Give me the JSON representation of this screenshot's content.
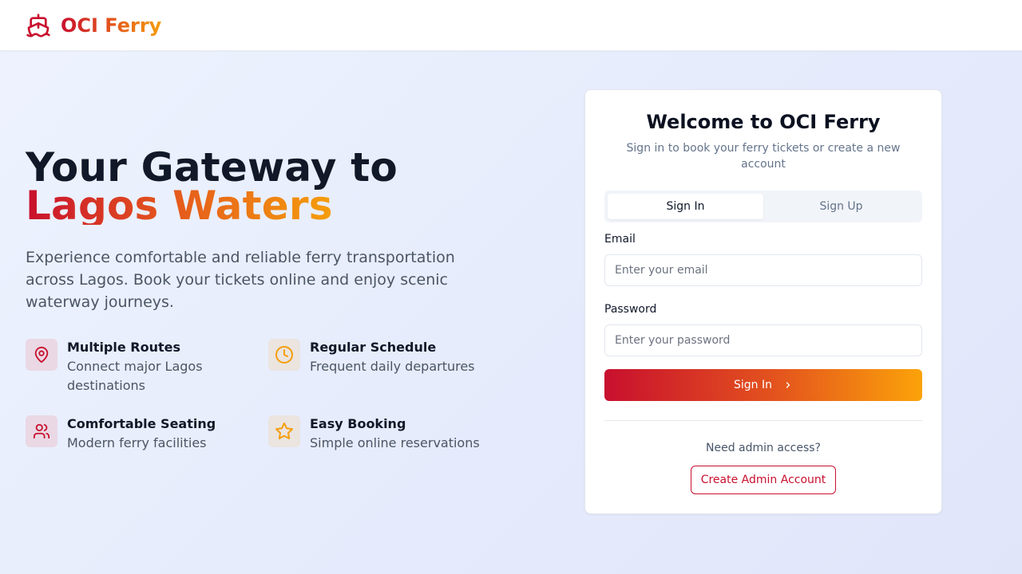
{
  "header": {
    "brand": "OCI Ferry",
    "logo_icon": "ship-icon"
  },
  "hero": {
    "title_line1": "Your Gateway to",
    "title_line2": "Lagos Waters",
    "description": "Experience comfortable and reliable ferry transportation across Lagos. Book your tickets online and enjoy scenic waterway journeys."
  },
  "features": [
    {
      "icon": "map-pin-icon",
      "title": "Multiple Routes",
      "description": "Connect major Lagos destinations"
    },
    {
      "icon": "clock-icon",
      "title": "Regular Schedule",
      "description": "Frequent daily departures"
    },
    {
      "icon": "users-icon",
      "title": "Comfortable Seating",
      "description": "Modern ferry facilities"
    },
    {
      "icon": "star-icon",
      "title": "Easy Booking",
      "description": "Simple online reservations"
    }
  ],
  "auth": {
    "title": "Welcome to OCI Ferry",
    "subtitle": "Sign in to book your ferry tickets or create a new account",
    "tabs": [
      "Sign In",
      "Sign Up"
    ],
    "active_tab": "Sign In",
    "email_label": "Email",
    "email_placeholder": "Enter your email",
    "email_value": "",
    "password_label": "Password",
    "password_placeholder": "Enter your password",
    "password_value": "",
    "submit_label": "Sign In",
    "admin_prompt": "Need admin access?",
    "admin_button": "Create Admin Account"
  },
  "colors": {
    "brand_red": "#c8102e",
    "brand_orange": "#e4551d",
    "brand_amber": "#f59e0b",
    "text_dark": "#111827",
    "text_muted": "#4b5563"
  }
}
